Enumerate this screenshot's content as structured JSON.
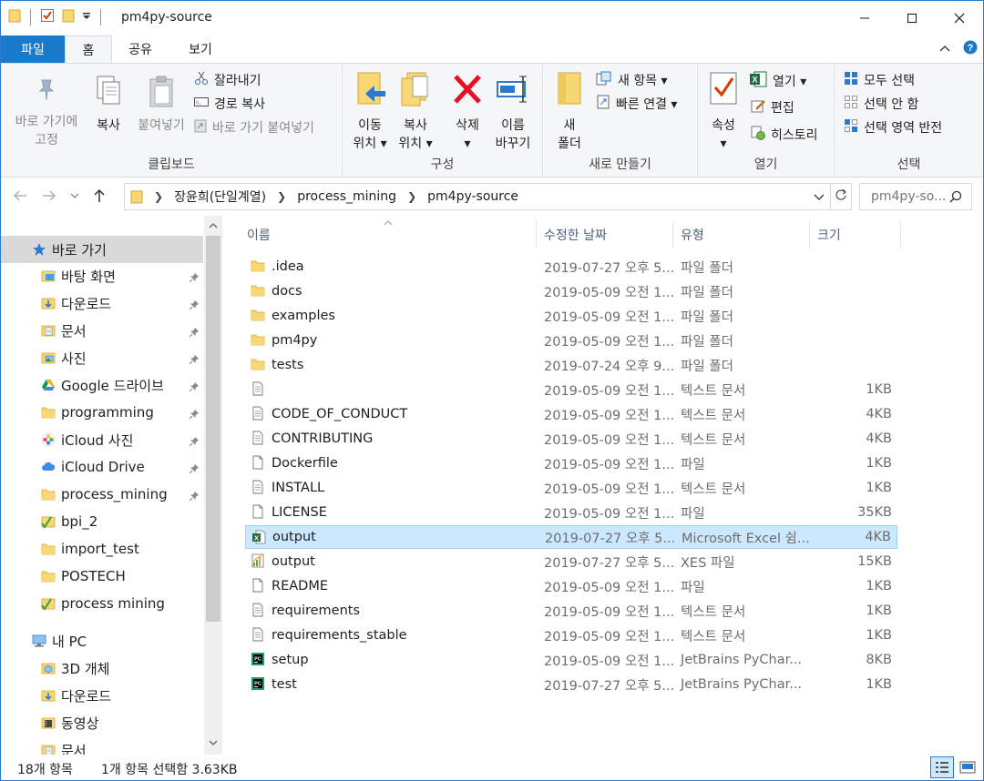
{
  "window": {
    "title": "pm4py-source"
  },
  "ribbon_tabs": [
    "파일",
    "홈",
    "공유",
    "보기"
  ],
  "ribbon": {
    "clipboard": {
      "label": "클립보드",
      "pin_line1": "바로 가기에",
      "pin_line2": "고정",
      "copy": "복사",
      "paste": "붙여넣기",
      "cut": "잘라내기",
      "copy_path": "경로 복사",
      "paste_shortcut": "바로 가기 붙여넣기"
    },
    "organize": {
      "label": "구성",
      "move_line1": "이동",
      "move_line2": "위치 ▾",
      "copyto_line1": "복사",
      "copyto_line2": "위치 ▾",
      "delete_line1": "삭제",
      "delete_line2": "▾",
      "rename_line1": "이름",
      "rename_line2": "바꾸기"
    },
    "new": {
      "label": "새로 만들기",
      "folder_line1": "새",
      "folder_line2": "폴더",
      "new_item": "새 항목 ▾",
      "easy_access": "빠른 연결 ▾"
    },
    "open": {
      "label": "열기",
      "properties_line1": "속성",
      "properties_line2": "▾",
      "open": "열기 ▾",
      "edit": "편집",
      "history": "히스토리"
    },
    "select": {
      "label": "선택",
      "select_all": "모두 선택",
      "select_none": "선택 안 함",
      "invert": "선택 영역 반전"
    }
  },
  "address": {
    "crumbs": [
      "장윤희(단일계열)",
      "process_mining",
      "pm4py-source"
    ],
    "search_placeholder": "pm4py-so..."
  },
  "nav": {
    "items": [
      {
        "label": "바로 가기",
        "icon": "star-icon",
        "pinned": false
      },
      {
        "label": "바탕 화면",
        "icon": "folder-blue-icon",
        "pinned": true
      },
      {
        "label": "다운로드",
        "icon": "download-folder-icon",
        "pinned": true
      },
      {
        "label": "문서",
        "icon": "documents-icon",
        "pinned": true
      },
      {
        "label": "사진",
        "icon": "pictures-icon",
        "pinned": true
      },
      {
        "label": "Google 드라이브",
        "icon": "google-drive-icon",
        "pinned": true
      },
      {
        "label": "programming",
        "icon": "folder-icon",
        "pinned": true
      },
      {
        "label": "iCloud 사진",
        "icon": "icloud-photos-icon",
        "pinned": true
      },
      {
        "label": "iCloud Drive",
        "icon": "icloud-drive-icon",
        "pinned": true
      },
      {
        "label": "process_mining",
        "icon": "folder-icon",
        "pinned": true
      },
      {
        "label": "bpi_2",
        "icon": "folder-check-icon",
        "pinned": false
      },
      {
        "label": "import_test",
        "icon": "folder-icon",
        "pinned": false
      },
      {
        "label": "POSTECH",
        "icon": "folder-icon",
        "pinned": false
      },
      {
        "label": "process mining",
        "icon": "folder-check-icon",
        "pinned": false
      },
      {
        "label": "내 PC",
        "icon": "pc-icon",
        "pinned": false
      },
      {
        "label": "3D 개체",
        "icon": "3d-objects-icon",
        "pinned": false
      },
      {
        "label": "다운로드",
        "icon": "download-folder-icon",
        "pinned": false
      },
      {
        "label": "동영상",
        "icon": "videos-icon",
        "pinned": false
      },
      {
        "label": "문서",
        "icon": "documents-icon",
        "pinned": false
      }
    ]
  },
  "columns": [
    "이름",
    "수정한 날짜",
    "유형",
    "크기"
  ],
  "files": [
    {
      "name": ".idea",
      "date": "2019-07-27 오후 5...",
      "type": "파일 폴더",
      "size": "",
      "icon": "folder-icon"
    },
    {
      "name": "docs",
      "date": "2019-05-09 오전 1...",
      "type": "파일 폴더",
      "size": "",
      "icon": "folder-icon"
    },
    {
      "name": "examples",
      "date": "2019-05-09 오전 1...",
      "type": "파일 폴더",
      "size": "",
      "icon": "folder-icon"
    },
    {
      "name": "pm4py",
      "date": "2019-05-09 오전 1...",
      "type": "파일 폴더",
      "size": "",
      "icon": "folder-icon"
    },
    {
      "name": "tests",
      "date": "2019-07-24 오후 9...",
      "type": "파일 폴더",
      "size": "",
      "icon": "folder-icon"
    },
    {
      "name": "",
      "date": "2019-05-09 오전 1...",
      "type": "텍스트 문서",
      "size": "1KB",
      "icon": "text-file-icon"
    },
    {
      "name": "CODE_OF_CONDUCT",
      "date": "2019-05-09 오전 1...",
      "type": "텍스트 문서",
      "size": "4KB",
      "icon": "text-file-icon"
    },
    {
      "name": "CONTRIBUTING",
      "date": "2019-05-09 오전 1...",
      "type": "텍스트 문서",
      "size": "4KB",
      "icon": "text-file-icon"
    },
    {
      "name": "Dockerfile",
      "date": "2019-05-09 오전 1...",
      "type": "파일",
      "size": "1KB",
      "icon": "blank-file-icon"
    },
    {
      "name": "INSTALL",
      "date": "2019-05-09 오전 1...",
      "type": "텍스트 문서",
      "size": "1KB",
      "icon": "text-file-icon"
    },
    {
      "name": "LICENSE",
      "date": "2019-05-09 오전 1...",
      "type": "파일",
      "size": "35KB",
      "icon": "blank-file-icon"
    },
    {
      "name": "output",
      "date": "2019-07-27 오후 5...",
      "type": "Microsoft Excel 쉼...",
      "size": "4KB",
      "icon": "excel-file-icon",
      "selected": true
    },
    {
      "name": "output",
      "date": "2019-07-27 오후 5...",
      "type": "XES 파일",
      "size": "15KB",
      "icon": "xes-file-icon"
    },
    {
      "name": "README",
      "date": "2019-05-09 오전 1...",
      "type": "파일",
      "size": "1KB",
      "icon": "blank-file-icon"
    },
    {
      "name": "requirements",
      "date": "2019-05-09 오전 1...",
      "type": "텍스트 문서",
      "size": "1KB",
      "icon": "text-file-icon"
    },
    {
      "name": "requirements_stable",
      "date": "2019-05-09 오전 1...",
      "type": "텍스트 문서",
      "size": "1KB",
      "icon": "text-file-icon"
    },
    {
      "name": "setup",
      "date": "2019-05-09 오전 1...",
      "type": "JetBrains PyChar...",
      "size": "8KB",
      "icon": "pycharm-file-icon"
    },
    {
      "name": "test",
      "date": "2019-07-27 오후 5...",
      "type": "JetBrains PyChar...",
      "size": "1KB",
      "icon": "pycharm-file-icon"
    }
  ],
  "status": {
    "count": "18개 항목",
    "selection": "1개 항목 선택함 3.63KB"
  },
  "colors": {
    "accent": "#1979ca",
    "selection_bg": "#cce8ff",
    "selection_border": "#99d1ff",
    "folder": "#f8d775"
  }
}
